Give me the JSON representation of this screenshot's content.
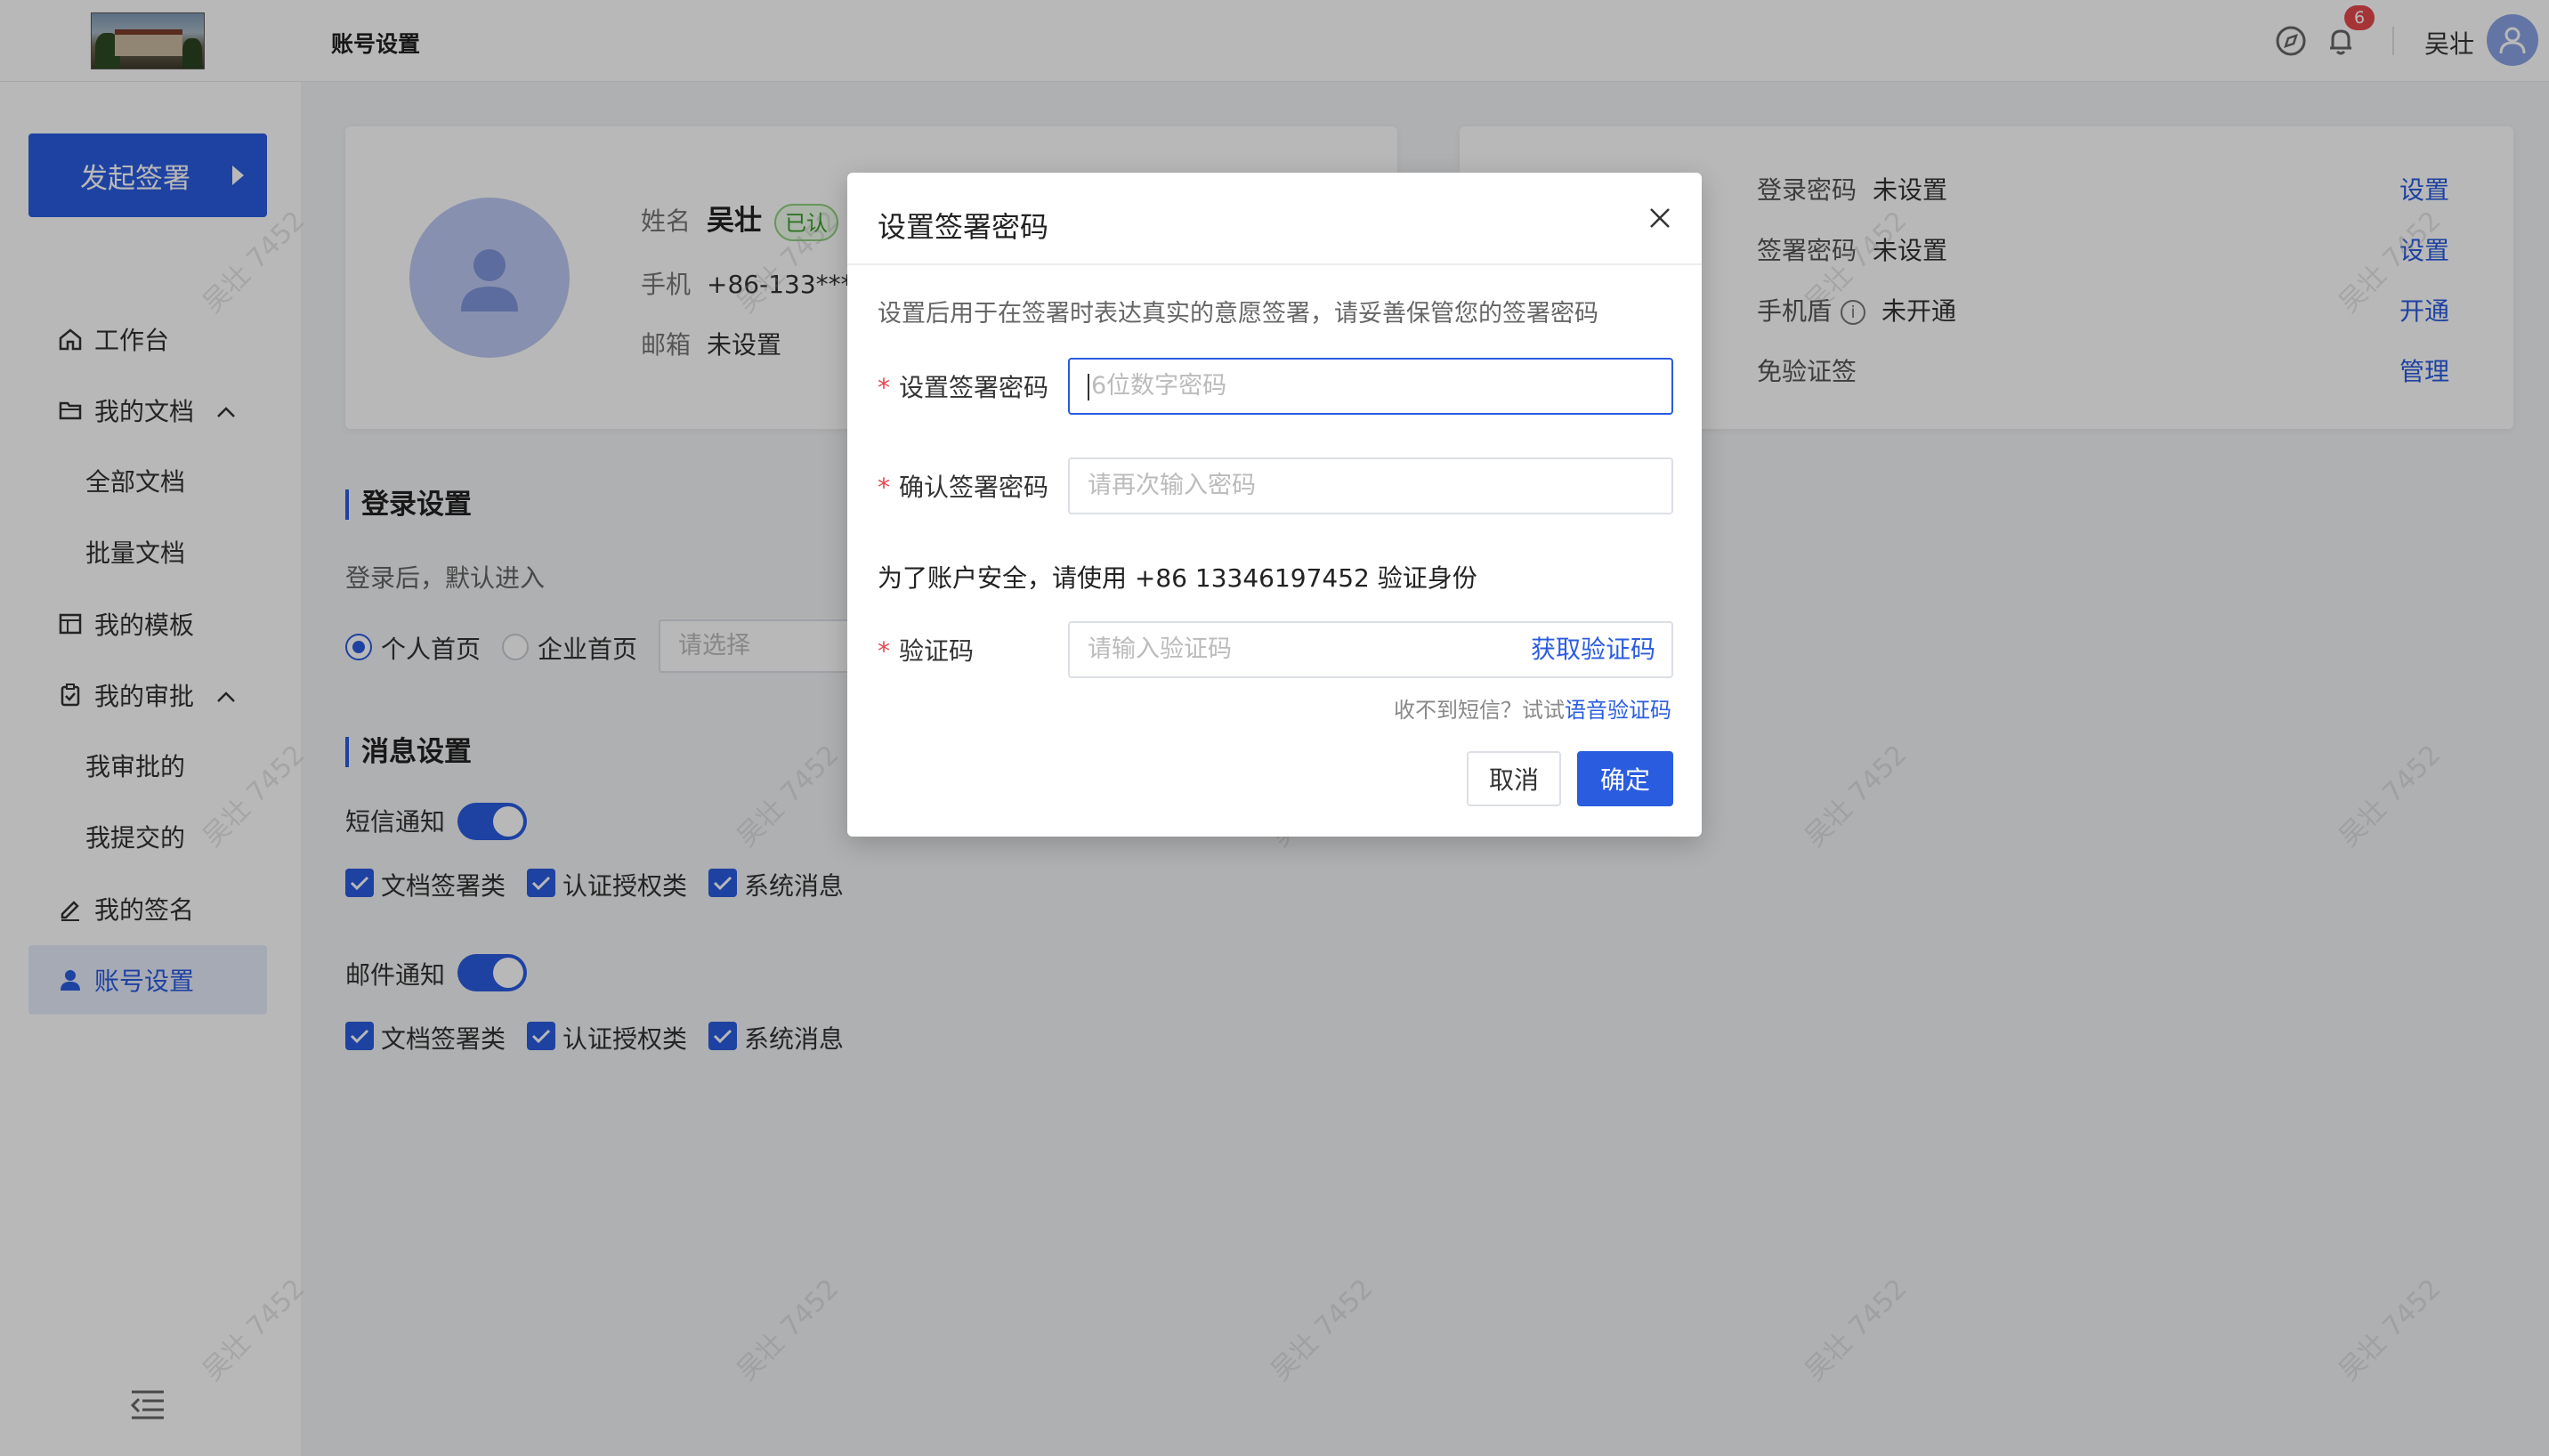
{
  "topbar": {
    "page_title": "账号设置",
    "notification_count": "6",
    "user_name": "吴壮"
  },
  "sidebar": {
    "start_button": "发起签署",
    "items": {
      "workbench": "工作台",
      "my_docs": "我的文档",
      "all_docs": "全部文档",
      "batch_docs": "批量文档",
      "my_templates": "我的模板",
      "my_approvals": "我的审批",
      "approved_by_me": "我审批的",
      "submitted_by_me": "我提交的",
      "my_signature": "我的签名",
      "account_settings": "账号设置"
    }
  },
  "profile": {
    "name_label": "姓名",
    "name_value": "吴壮",
    "verified_badge": "已认",
    "phone_label": "手机",
    "phone_value": "+86-133****",
    "email_label": "邮箱",
    "email_value": "未设置"
  },
  "security": {
    "rows": [
      {
        "label": "登录密码",
        "status": "未设置",
        "action": "设置"
      },
      {
        "label": "签署密码",
        "status": "未设置",
        "action": "设置"
      },
      {
        "label": "手机盾",
        "status": "未开通",
        "action": "开通"
      },
      {
        "label": "免验证签",
        "status": "",
        "action": "管理"
      }
    ]
  },
  "login_settings": {
    "title": "登录设置",
    "desc": "登录后，默认进入",
    "option_personal": "个人首页",
    "option_enterprise": "企业首页",
    "select_placeholder": "请选择"
  },
  "message_settings": {
    "title": "消息设置",
    "sms_label": "短信通知",
    "email_label": "邮件通知",
    "categories": [
      "文档签署类",
      "认证授权类",
      "系统消息"
    ]
  },
  "watermark": "吴壮 7452",
  "dialog": {
    "title": "设置签署密码",
    "description": "设置后用于在签署时表达真实的意愿签署，请妥善保管您的签署密码",
    "password_label": "设置签署密码",
    "password_placeholder": "6位数字密码",
    "confirm_label": "确认签署密码",
    "confirm_placeholder": "请再次输入密码",
    "security_notice": "为了账户安全，请使用 +86 13346197452 验证身份",
    "code_label": "验证码",
    "code_placeholder": "请输入验证码",
    "get_code": "获取验证码",
    "hint_prefix": "收不到短信？试试",
    "hint_link": "语音验证码",
    "cancel": "取消",
    "confirm": "确定"
  }
}
